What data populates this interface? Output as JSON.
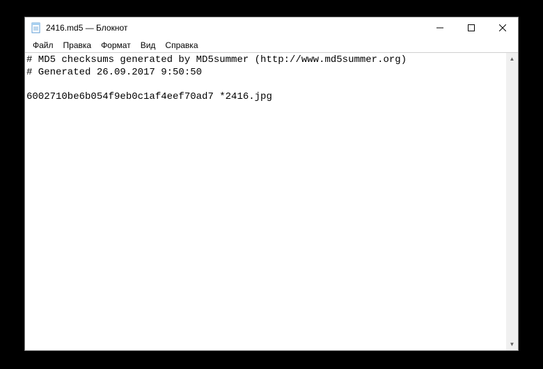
{
  "window": {
    "title": "2416.md5 — Блокнот"
  },
  "menu": {
    "file": "Файл",
    "edit": "Правка",
    "format": "Формат",
    "view": "Вид",
    "help": "Справка"
  },
  "content": {
    "line1": "# MD5 checksums generated by MD5summer (http://www.md5summer.org)",
    "line2": "# Generated 26.09.2017 9:50:50",
    "line3": "",
    "line4": "6002710be6b054f9eb0c1af4eef70ad7 *2416.jpg"
  }
}
